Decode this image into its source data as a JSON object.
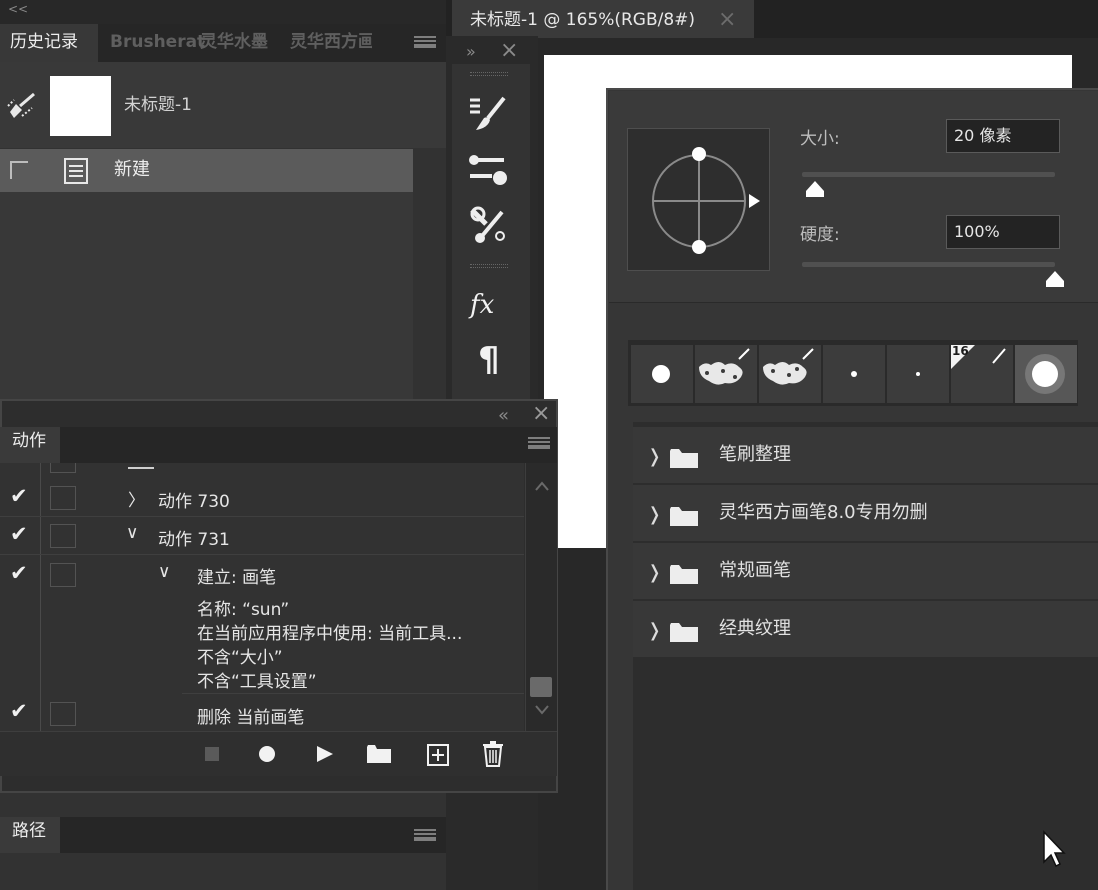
{
  "history_panel": {
    "collapse_glyph": "<<",
    "tabs": [
      {
        "label": "历史记录",
        "active": true
      },
      {
        "label": "Brusherat",
        "active": false
      },
      {
        "label": "灵华水墨",
        "active": false
      },
      {
        "label": "灵华西方画",
        "active": false
      }
    ],
    "menu_icon": "panel-menu-icon",
    "snapshot_label": "未标题-1",
    "snapshot_icon": "history-brush-icon",
    "history_items": [
      {
        "label": "新建",
        "icon": "document-icon"
      }
    ]
  },
  "tool_strip": {
    "expand_glyph": "»",
    "close_glyph": "×",
    "icons": [
      "brush-settings-icon",
      "brush-presets-icon",
      "tool-presets-icon",
      "fx-styles-icon",
      "paragraph-icon"
    ],
    "fx_label": "fx",
    "paragraph_label": "¶"
  },
  "document": {
    "tab_title": "未标题-1 @ 165%(RGB/8#)",
    "close_glyph": "×"
  },
  "brush_picker": {
    "size_label": "大小:",
    "size_value": "20 像素",
    "size_slider_fraction": 0.05,
    "hardness_label": "硬度:",
    "hardness_value": "100%",
    "hardness_slider_fraction": 1.0,
    "recent_swatches_badge": "16",
    "folders": [
      {
        "name": "笔刷整理"
      },
      {
        "name": "灵华西方画笔8.0专用勿删"
      },
      {
        "name": "常规画笔"
      },
      {
        "name": "经典纹理"
      }
    ]
  },
  "actions_panel": {
    "collapse_glyph": "«",
    "close_glyph": "×",
    "tab_label": "动作",
    "rows": [
      {
        "check": "✔",
        "expand": "〉",
        "label": "动作 730"
      },
      {
        "check": "✔",
        "expand": "∨",
        "label": "动作 731"
      },
      {
        "check": "✔",
        "expand": "∨",
        "label": "建立: 画笔"
      }
    ],
    "details": [
      "名称: “sun”",
      "在当前应用程序中使用: 当前工具...",
      "不含“大小”",
      "不含“工具设置”"
    ],
    "last_row": {
      "check": "✔",
      "label": "删除 当前画笔"
    },
    "footer_icons": [
      "stop-icon",
      "record-icon",
      "play-icon",
      "new-set-folder-icon",
      "new-action-icon",
      "delete-icon"
    ]
  },
  "paths_panel": {
    "tab_label": "路径"
  },
  "colors": {
    "panel_bg": "#323232",
    "selected_row": "#5b5b5b",
    "canvas": "#ffffff"
  }
}
